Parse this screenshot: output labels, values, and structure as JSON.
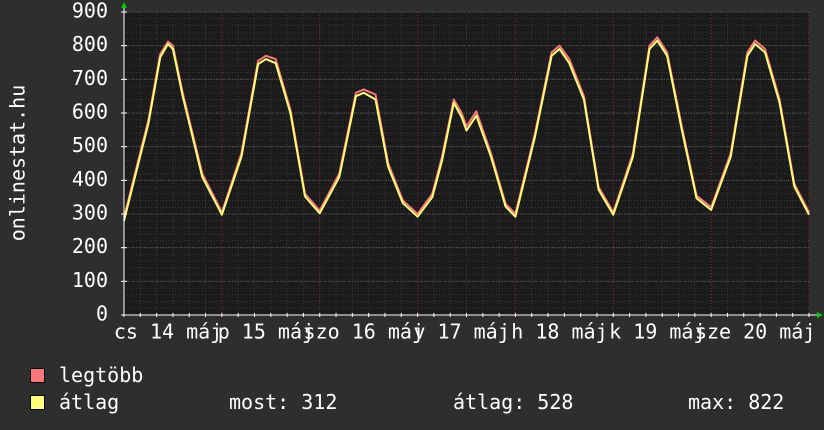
{
  "chart_data": {
    "type": "line",
    "ylabel": "onlinestat.hu",
    "ylim": [
      0,
      900
    ],
    "y_ticks": [
      "0",
      "100",
      "200",
      "300",
      "400",
      "500",
      "600",
      "700",
      "800",
      "900"
    ],
    "x_range_days": [
      0,
      7
    ],
    "x_ticks": [
      {
        "label": "cs 14 máj",
        "day": 0.45
      },
      {
        "label": "p 15 máj",
        "day": 1.45
      },
      {
        "label": "szo 16 máj",
        "day": 2.45
      },
      {
        "label": "v 17 máj",
        "day": 3.45
      },
      {
        "label": "h 18 máj",
        "day": 4.45
      },
      {
        "label": "k 19 máj",
        "day": 5.45
      },
      {
        "label": "sze 20 máj",
        "day": 6.45
      }
    ],
    "grid": true,
    "series": [
      {
        "name": "legtöbb",
        "color": "#ff7777",
        "x": [
          0.0,
          0.25,
          0.37,
          0.45,
          0.5,
          0.6,
          0.8,
          1.0,
          1.2,
          1.37,
          1.45,
          1.55,
          1.7,
          1.85,
          2.0,
          2.2,
          2.37,
          2.45,
          2.57,
          2.7,
          2.85,
          3.0,
          3.15,
          3.25,
          3.37,
          3.45,
          3.5,
          3.6,
          3.75,
          3.9,
          4.0,
          4.2,
          4.37,
          4.45,
          4.55,
          4.7,
          4.85,
          5.0,
          5.2,
          5.37,
          5.45,
          5.55,
          5.7,
          5.85,
          6.0,
          6.2,
          6.37,
          6.45,
          6.55,
          6.7,
          6.85,
          7.0
        ],
        "y": [
          290,
          580,
          775,
          812,
          800,
          660,
          420,
          305,
          480,
          755,
          770,
          760,
          610,
          360,
          310,
          420,
          660,
          670,
          655,
          450,
          340,
          300,
          360,
          470,
          640,
          600,
          560,
          605,
          480,
          330,
          300,
          540,
          780,
          800,
          760,
          650,
          380,
          305,
          480,
          800,
          825,
          780,
          560,
          355,
          320,
          480,
          780,
          815,
          790,
          640,
          390,
          305
        ]
      },
      {
        "name": "átlag",
        "color": "#ffff77",
        "x": [
          0.0,
          0.25,
          0.37,
          0.45,
          0.5,
          0.6,
          0.8,
          1.0,
          1.2,
          1.37,
          1.45,
          1.55,
          1.7,
          1.85,
          2.0,
          2.2,
          2.37,
          2.45,
          2.57,
          2.7,
          2.85,
          3.0,
          3.15,
          3.25,
          3.37,
          3.45,
          3.5,
          3.6,
          3.75,
          3.9,
          4.0,
          4.2,
          4.37,
          4.45,
          4.55,
          4.7,
          4.85,
          5.0,
          5.2,
          5.37,
          5.45,
          5.55,
          5.7,
          5.85,
          6.0,
          6.2,
          6.37,
          6.45,
          6.55,
          6.7,
          6.85,
          7.0
        ],
        "y": [
          280,
          570,
          765,
          805,
          790,
          650,
          410,
          298,
          470,
          745,
          760,
          748,
          600,
          352,
          302,
          410,
          650,
          660,
          640,
          440,
          332,
          292,
          350,
          458,
          630,
          588,
          548,
          592,
          470,
          322,
          292,
          530,
          770,
          790,
          748,
          640,
          372,
          298,
          470,
          790,
          815,
          770,
          550,
          347,
          312,
          470,
          770,
          805,
          780,
          630,
          382,
          298
        ]
      }
    ],
    "legend": {
      "placement": "bottom-left"
    },
    "stats": {
      "most": "most: 312",
      "atlag": "átlag: 528",
      "max": "max: 822"
    }
  },
  "colors": {
    "background": "#2e2e2e",
    "plot_background": "#1b1b1b",
    "grid": "#484848",
    "axis": "#ffffff",
    "arrow": "#00cc00"
  }
}
